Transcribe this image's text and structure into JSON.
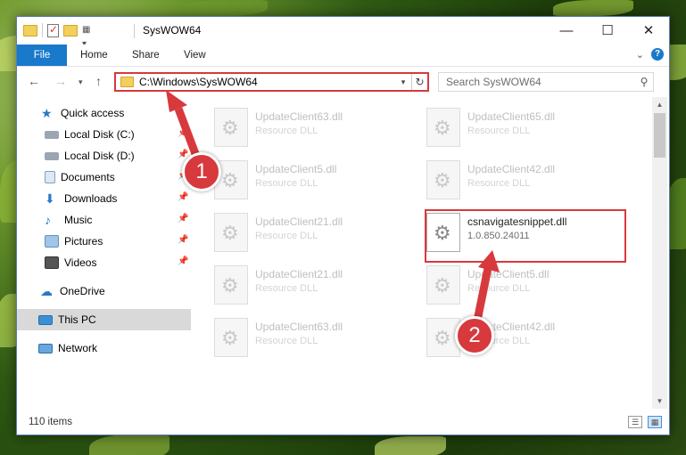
{
  "window": {
    "title": "SysWOW64"
  },
  "ribbon": {
    "tabs": [
      "File",
      "Home",
      "Share",
      "View"
    ]
  },
  "address": {
    "path": "C:\\Windows\\SysWOW64"
  },
  "search": {
    "placeholder": "Search SysWOW64"
  },
  "sidebar": {
    "items": [
      {
        "label": "Quick access",
        "icon": "star-icon"
      },
      {
        "label": "Local Disk (C:)",
        "icon": "drive-icon",
        "pinned": true
      },
      {
        "label": "Local Disk (D:)",
        "icon": "drive-icon",
        "pinned": true
      },
      {
        "label": "Documents",
        "icon": "documents-icon",
        "pinned": true
      },
      {
        "label": "Downloads",
        "icon": "downloads-icon",
        "pinned": true
      },
      {
        "label": "Music",
        "icon": "music-icon",
        "pinned": true
      },
      {
        "label": "Pictures",
        "icon": "pictures-icon",
        "pinned": true
      },
      {
        "label": "Videos",
        "icon": "videos-icon",
        "pinned": true
      },
      {
        "label": "OneDrive",
        "icon": "cloud-icon"
      },
      {
        "label": "This PC",
        "icon": "pc-icon",
        "selected": true
      },
      {
        "label": "Network",
        "icon": "network-icon"
      }
    ]
  },
  "files": [
    {
      "name": "UpdateClient63.dll",
      "sub": "Resource DLL"
    },
    {
      "name": "UpdateClient65.dll",
      "sub": "Resource DLL"
    },
    {
      "name": "UpdateClient5.dll",
      "sub": "Resource DLL"
    },
    {
      "name": "UpdateClient42.dll",
      "sub": "Resource DLL"
    },
    {
      "name": "UpdateClient21.dll",
      "sub": "Resource DLL"
    },
    {
      "name": "csnavigatesnippet.dll",
      "sub": "1.0.850.24011",
      "focused": true
    },
    {
      "name": "UpdateClient21.dll",
      "sub": "Resource DLL"
    },
    {
      "name": "UpdateClient5.dll",
      "sub": "Resource DLL"
    },
    {
      "name": "UpdateClient63.dll",
      "sub": "Resource DLL"
    },
    {
      "name": "UpdateClient42.dll",
      "sub": "Resource DLL"
    }
  ],
  "status": {
    "count": "110 items"
  },
  "annotations": {
    "step1": "1",
    "step2": "2"
  },
  "colors": {
    "accent": "#1979ca",
    "highlight": "#d7393d"
  }
}
